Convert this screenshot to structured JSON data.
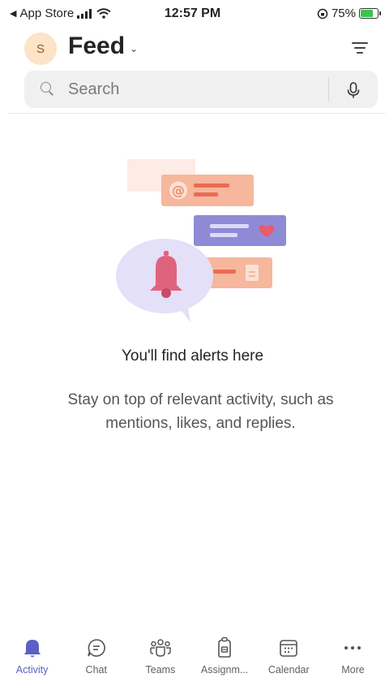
{
  "status_bar": {
    "back_app": "App Store",
    "time": "12:57 PM",
    "battery": "75%",
    "battery_level": 0.75
  },
  "header": {
    "avatar_initial": "S",
    "title": "Feed"
  },
  "search": {
    "placeholder": "Search"
  },
  "empty_state": {
    "title": "You'll find alerts here",
    "description": "Stay on top of relevant activity, such as mentions, likes, and replies."
  },
  "tabs": [
    {
      "label": "Activity",
      "icon": "bell-icon",
      "active": true
    },
    {
      "label": "Chat",
      "icon": "chat-icon",
      "active": false
    },
    {
      "label": "Teams",
      "icon": "teams-icon",
      "active": false
    },
    {
      "label": "Assignm...",
      "icon": "assignments-icon",
      "active": false
    },
    {
      "label": "Calendar",
      "icon": "calendar-icon",
      "active": false
    },
    {
      "label": "More",
      "icon": "more-icon",
      "active": false
    }
  ],
  "colors": {
    "accent": "#5b5fc7",
    "avatar_bg": "#fde3c7",
    "card_orange": "#f6b79c",
    "card_purple": "#8f8ad6",
    "bubble_lavender": "#e4e0f8",
    "bell_red": "#e0637d"
  }
}
